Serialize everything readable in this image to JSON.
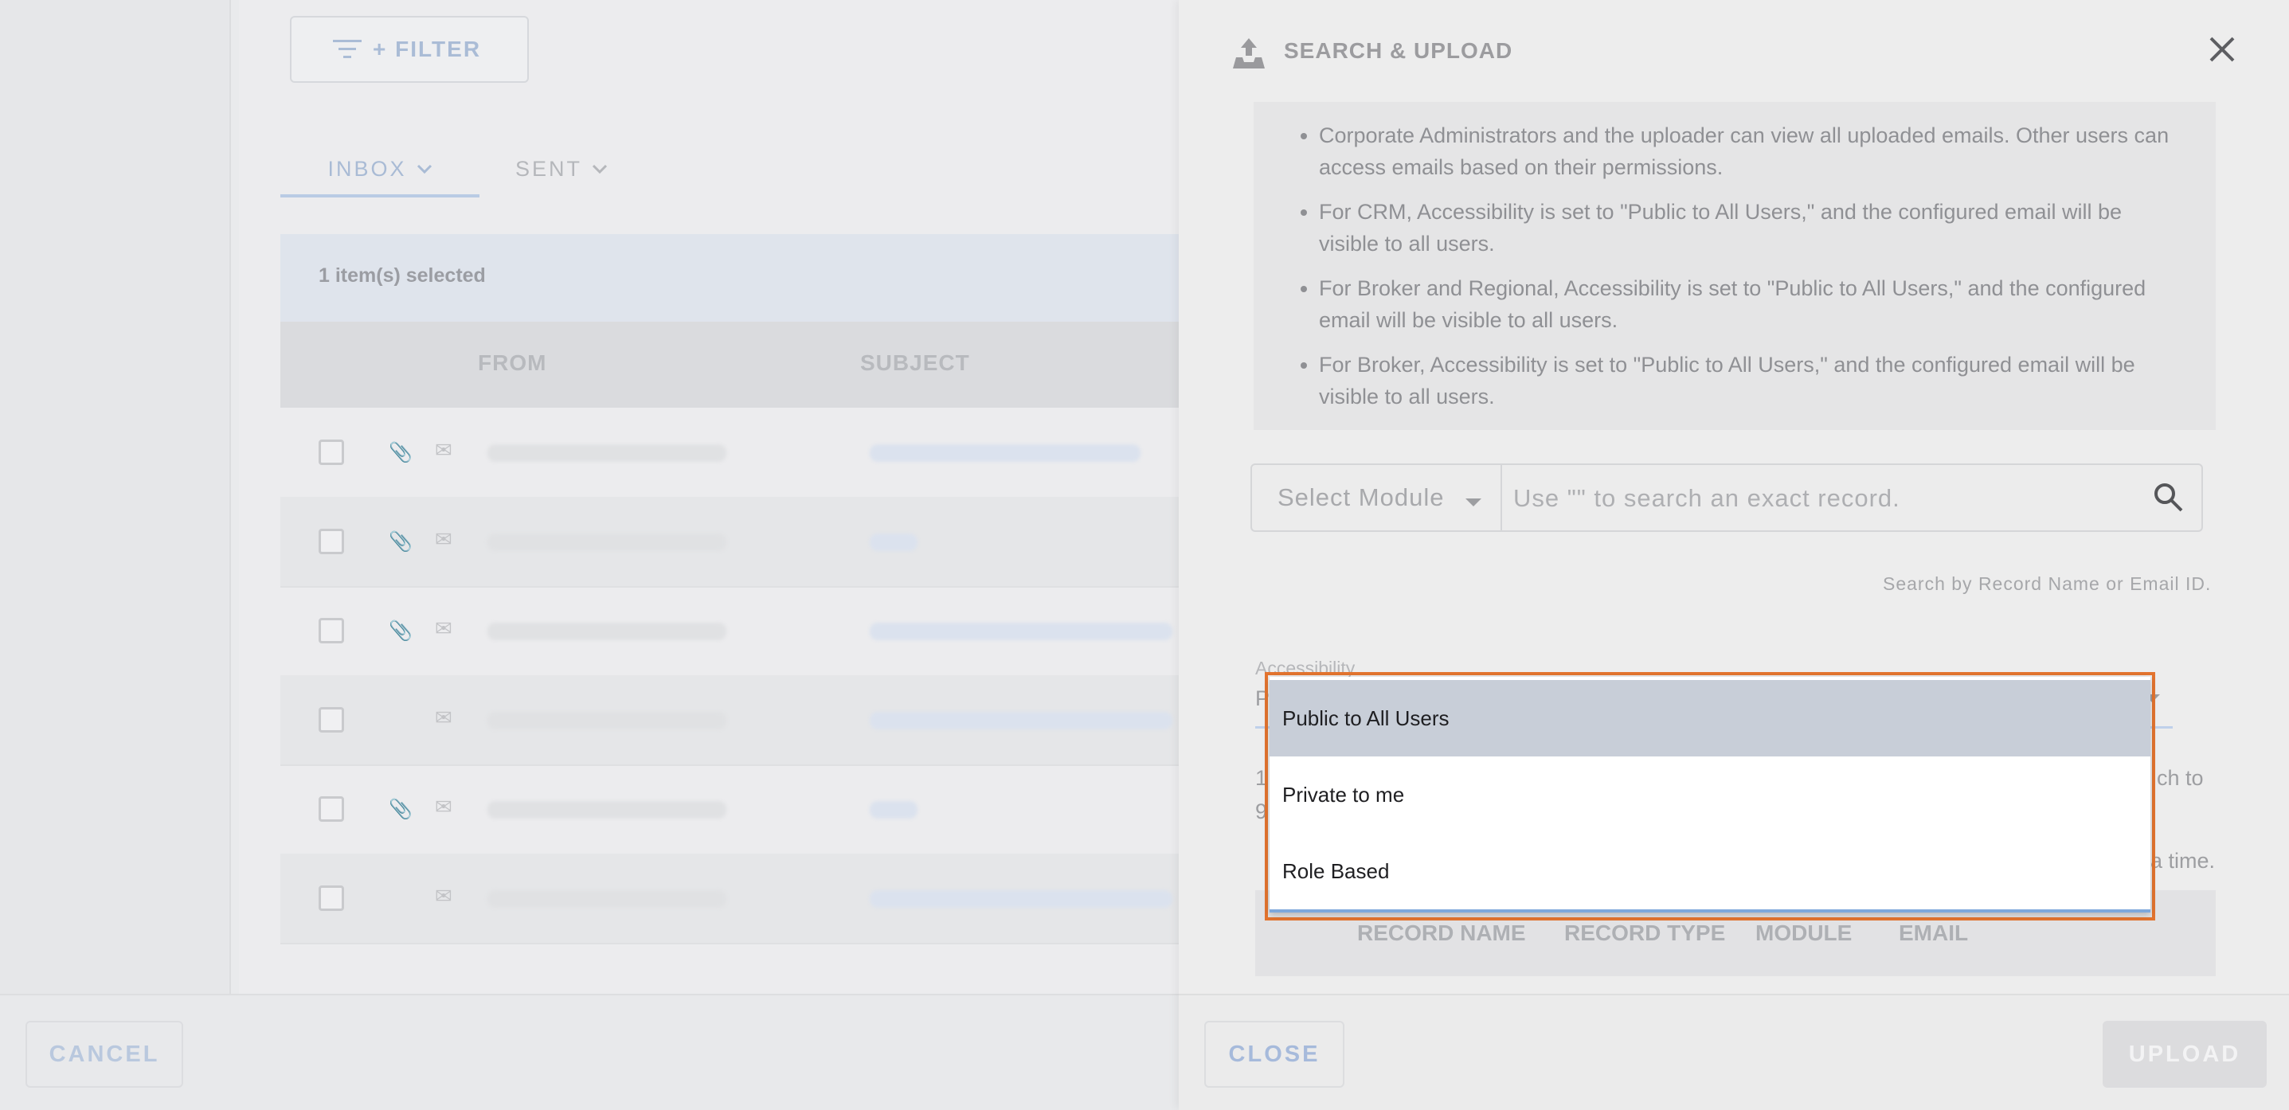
{
  "left_page": {
    "filter_label": "+ FILTER",
    "tabs": [
      {
        "label": "INBOX",
        "active": true
      },
      {
        "label": "SENT",
        "active": false
      }
    ],
    "selection_text": "1 item(s) selected",
    "table_headers": {
      "from": "FROM",
      "subject": "SUBJECT"
    },
    "rows": [
      {
        "has_attachment": true,
        "read": false
      },
      {
        "has_attachment": true,
        "read": false
      },
      {
        "has_attachment": true,
        "read": false
      },
      {
        "has_attachment": false,
        "read": true
      },
      {
        "has_attachment": true,
        "read": false
      },
      {
        "has_attachment": false,
        "read": false
      }
    ],
    "cancel_label": "CANCEL"
  },
  "panel": {
    "title": "SEARCH & UPLOAD",
    "info_items": [
      "Corporate Administrators and the uploader can view all uploaded emails. Other users can access emails based on their permissions.",
      "For CRM, Accessibility is set to \"Public to All Users,\" and the configured email will be visible to all users.",
      "For Broker and Regional, Accessibility is set to \"Public to All Users,\" and the configured email will be visible to all users.",
      "For Broker, Accessibility is set to \"Public to All Users,\" and the configured email will be visible to all users."
    ],
    "module_select_label": "Select Module",
    "search_placeholder": "Use \"\" to search an exact record.",
    "search_hint": "Search by Record Name or Email ID.",
    "accessibility_label": "Accessibility",
    "peek_text": {
      "left_1": "P",
      "left_2": "1",
      "left_3": "9",
      "right_1": "ch to",
      "right_2": "a time."
    },
    "record_headers": [
      "RECORD NAME",
      "RECORD TYPE",
      "MODULE",
      "EMAIL"
    ],
    "close_label": "CLOSE",
    "upload_label": "UPLOAD"
  },
  "dropdown": {
    "options": [
      {
        "label": "Public to All Users",
        "selected": true
      },
      {
        "label": "Private to me",
        "selected": false
      },
      {
        "label": "Role Based",
        "selected": false
      }
    ],
    "highlight_color": "#e3742f"
  },
  "colors": {
    "accent": "#a9bbd5",
    "overlay": "#e9eaec"
  }
}
